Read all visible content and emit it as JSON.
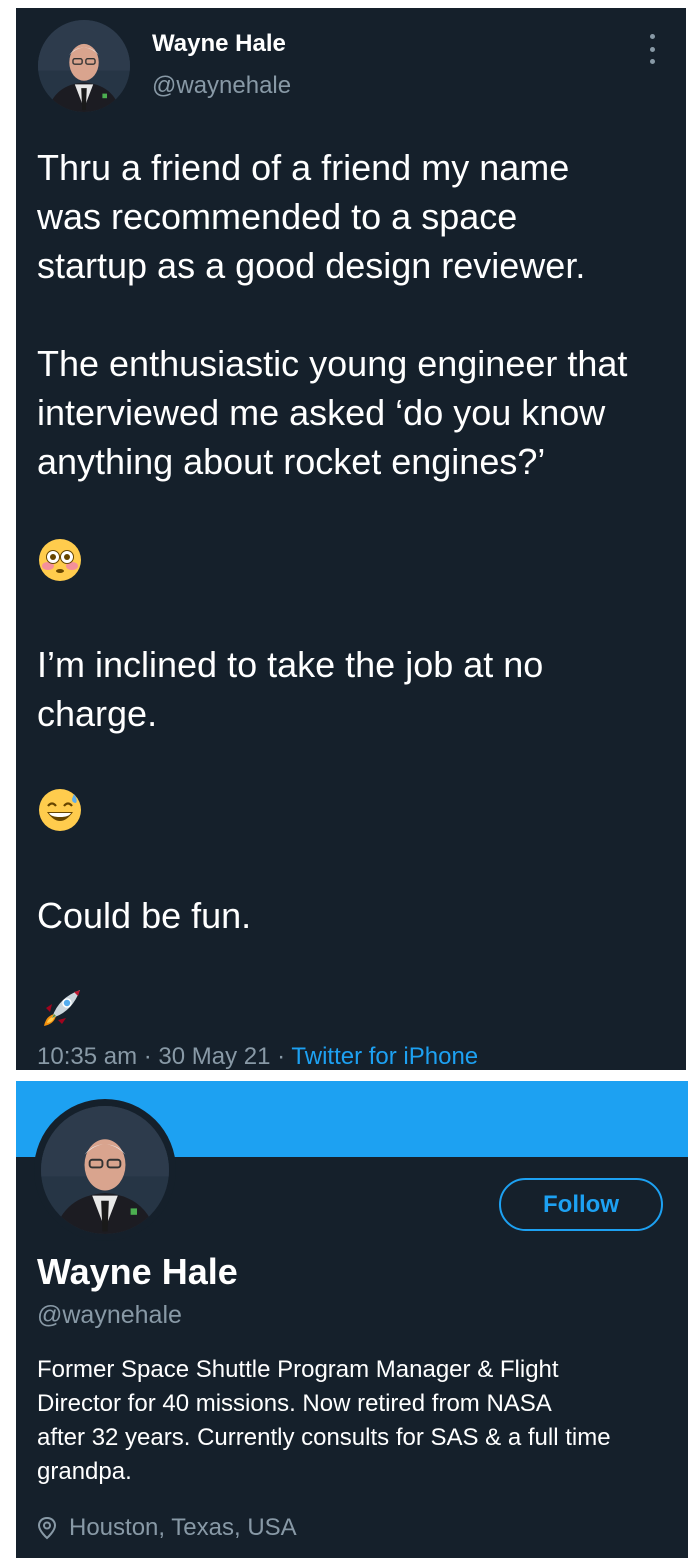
{
  "tweet": {
    "author": {
      "name": "Wayne Hale",
      "handle": "@waynehale"
    },
    "menu_icon": "more-vertical-icon",
    "paragraph1": [
      "Thru a friend of a friend my name",
      "was recommended to a space",
      "startup as a good design reviewer."
    ],
    "paragraph2": [
      "The enthusiastic young engineer that",
      "interviewed me asked ‘do you know",
      "anything about rocket engines?’"
    ],
    "emoji1": "flushed-face-emoji",
    "paragraph3": [
      "I’m inclined to take the job at no",
      "charge."
    ],
    "emoji2": "grinning-sweat-emoji",
    "paragraph4": [
      "Could be fun."
    ],
    "emoji3": "rocket-emoji",
    "time": "10:35 am",
    "separator": "·",
    "date": "30 May 21",
    "source": "Twitter for iPhone"
  },
  "profile": {
    "banner_color": "#1da1f2",
    "follow_label": "Follow",
    "name": "Wayne Hale",
    "handle": "@waynehale",
    "bio": [
      "Former Space Shuttle Program Manager & Flight",
      "Director for 40 missions. Now retired from NASA",
      "after 32 years. Currently consults for SAS & a full time",
      "grandpa."
    ],
    "location_icon": "location-pin-icon",
    "location": "Houston, Texas, USA"
  },
  "colors": {
    "background": "#15202b",
    "text": "#ffffff",
    "secondary": "#8899a6",
    "accent": "#1da1f2"
  }
}
